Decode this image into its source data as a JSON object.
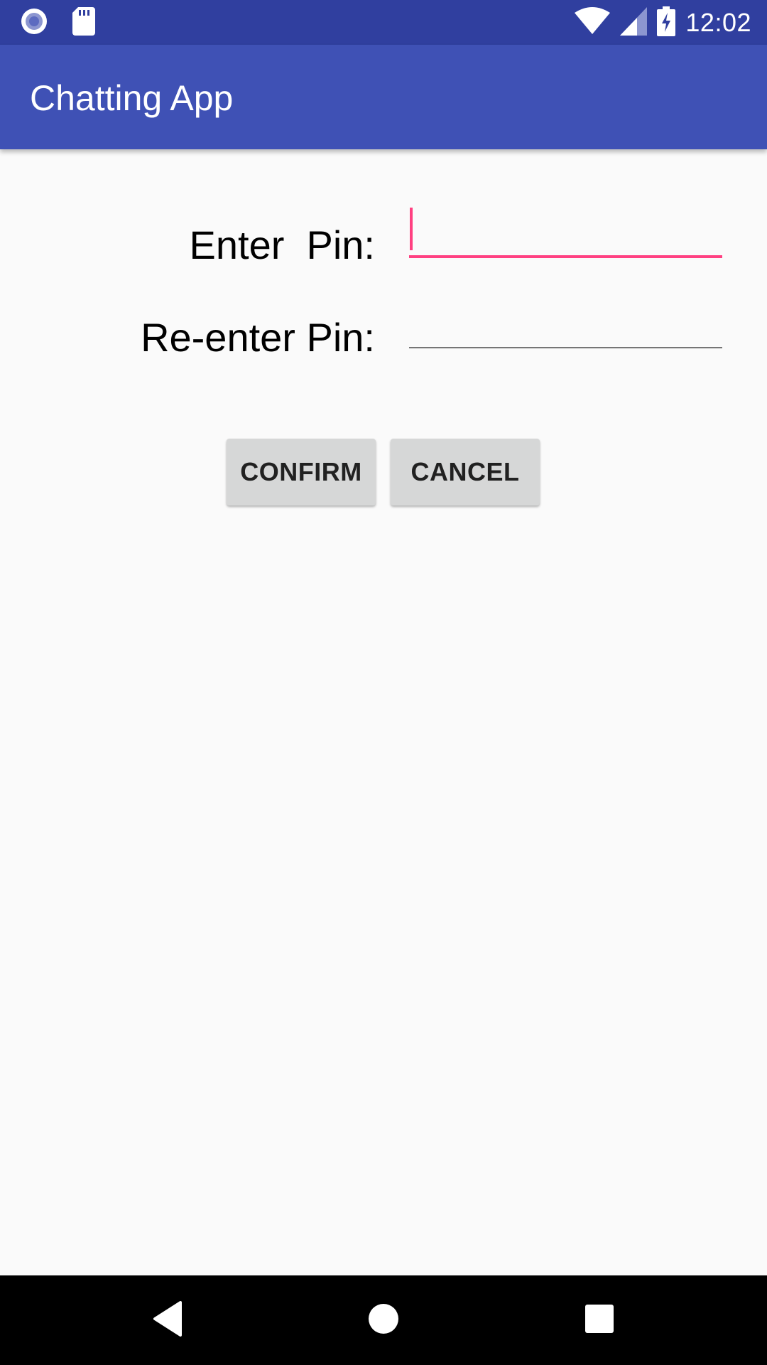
{
  "status_bar": {
    "time": "12:02",
    "icons": [
      "radio-circle-icon",
      "sd-card-icon",
      "wifi-icon",
      "cell-signal-icon",
      "battery-charging-icon"
    ],
    "background": "#303f9f"
  },
  "app_bar": {
    "title": "Chatting App",
    "background": "#3f51b5"
  },
  "form": {
    "enter_pin_label": "Enter  Pin:",
    "reenter_pin_label": "Re-enter Pin:",
    "enter_pin_value": "",
    "reenter_pin_value": "",
    "accent_color": "#ff4081"
  },
  "buttons": {
    "confirm_label": "CONFIRM",
    "cancel_label": "CANCEL"
  },
  "nav_bar": {
    "icons": [
      "back-icon",
      "home-icon",
      "recents-icon"
    ]
  }
}
